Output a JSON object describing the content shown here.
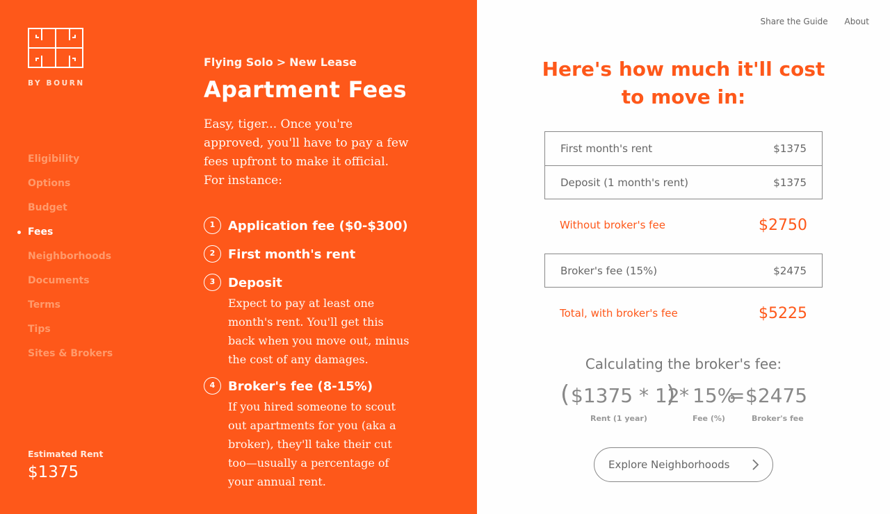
{
  "brand": {
    "logo_text": "BY BOURN"
  },
  "nav": {
    "items": [
      {
        "label": "Eligibility"
      },
      {
        "label": "Options"
      },
      {
        "label": "Budget"
      },
      {
        "label": "Fees",
        "active": true
      },
      {
        "label": "Neighborhoods"
      },
      {
        "label": "Documents"
      },
      {
        "label": "Terms"
      },
      {
        "label": "Tips"
      },
      {
        "label": "Sites & Brokers"
      }
    ]
  },
  "estimated_rent": {
    "label": "Estimated Rent",
    "value": "$1375"
  },
  "breadcrumb": {
    "part1": "Flying Solo",
    "separator": ">",
    "part2": "New Lease"
  },
  "page_title": "Apartment Fees",
  "intro": "Easy, tiger... Once you're approved, you'll have to pay a few fees upfront to make it official. For instance:",
  "fees": [
    {
      "num": "1",
      "title": "Application fee ($0-$300)",
      "desc": ""
    },
    {
      "num": "2",
      "title": "First month's rent",
      "desc": ""
    },
    {
      "num": "3",
      "title": "Deposit",
      "desc": "Expect to pay at least one month's rent. You'll get this back when you move out, minus the cost of any damages."
    },
    {
      "num": "4",
      "title": "Broker's fee (8-15%)",
      "desc": "If you hired someone to scout out apartments for you (aka a broker), they'll take their cut too—usually a percentage of your annual rent."
    }
  ],
  "top_nav": {
    "share": "Share the Guide",
    "about": "About"
  },
  "cost": {
    "heading_line1": "Here's how much it'll cost",
    "heading_line2": "to move in:",
    "first_month": {
      "label": "First month's rent",
      "value": "$1375"
    },
    "deposit": {
      "label": "Deposit (1 month's rent)",
      "value": "$1375"
    },
    "without_broker": {
      "label": "Without broker's fee",
      "value": "$2750"
    },
    "broker_fee": {
      "label": "Broker's fee (15%)",
      "value": "$2475"
    },
    "total": {
      "label": "Total, with broker's fee",
      "value": "$5225"
    }
  },
  "calc": {
    "label": "Calculating the broker's fee:",
    "open_paren": "(",
    "rent_expr": "$1375 * 12",
    "close_paren": ")",
    "times": "*",
    "fee_pct": "15%",
    "equals": "=",
    "result": "$2475",
    "cap_rent": "Rent (1 year)",
    "cap_fee": "Fee (%)",
    "cap_result": "Broker's fee"
  },
  "cta": {
    "label": "Explore Neighborhoods"
  },
  "colors": {
    "accent": "#fe581a",
    "muted_nav": "#ff9a6b",
    "panel_bg": "#fefefe"
  }
}
